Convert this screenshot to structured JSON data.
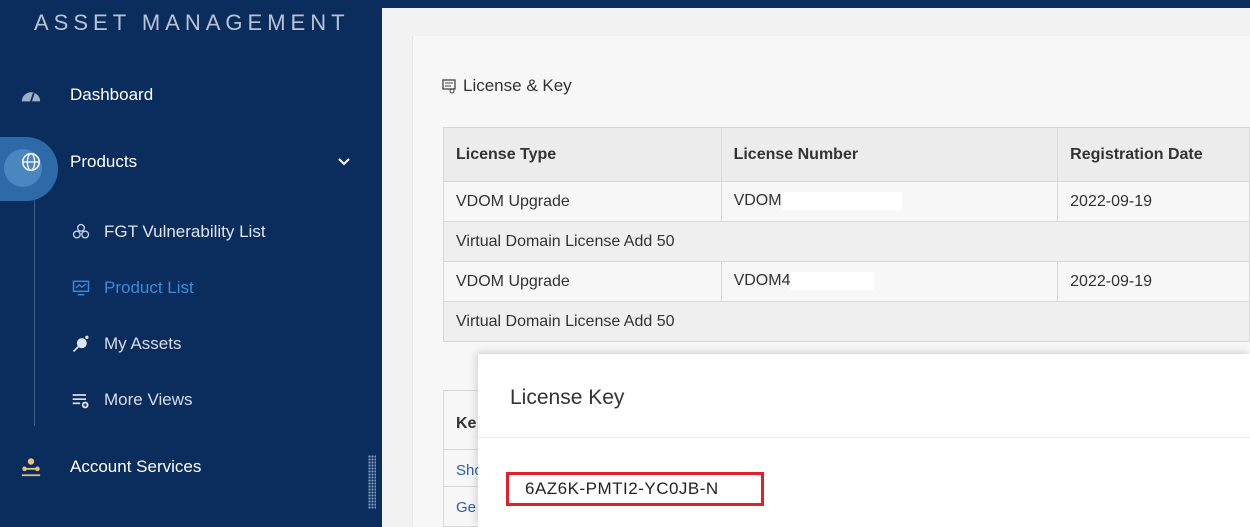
{
  "sidebar": {
    "brand": "ASSET MANAGEMENT",
    "items": [
      {
        "label": "Dashboard",
        "icon": "gauge-icon"
      },
      {
        "label": "Products",
        "icon": "globe-icon",
        "expanded": true
      },
      {
        "label": "Account Services",
        "icon": "users-icon"
      }
    ],
    "sub_items": [
      {
        "label": "FGT Vulnerability List",
        "icon": "biohazard-icon"
      },
      {
        "label": "Product List",
        "icon": "monitor-icon",
        "active": true
      },
      {
        "label": "My Assets",
        "icon": "satellite-icon"
      },
      {
        "label": "More Views",
        "icon": "list-add-icon"
      }
    ],
    "colors": {
      "bg": "#0a2d5e",
      "active": "#3b8bd9"
    }
  },
  "content": {
    "section_title": "License & Key",
    "table": {
      "headers": [
        "License Type",
        "License Number",
        "Registration Date"
      ],
      "rows": [
        {
          "type": "VDOM Upgrade",
          "number": "VDOM",
          "date": "2022-09-19",
          "description": "Virtual Domain License Add 50"
        },
        {
          "type": "VDOM Upgrade",
          "number": "VDOM4",
          "date": "2022-09-19",
          "description": "Virtual Domain License Add 50"
        }
      ]
    },
    "keys_table": {
      "header": "Ke",
      "links": [
        "Sho",
        "Ge"
      ]
    }
  },
  "modal": {
    "title": "License Key",
    "key_value": "6AZ6K-PMTI2-YC0JB-N"
  }
}
